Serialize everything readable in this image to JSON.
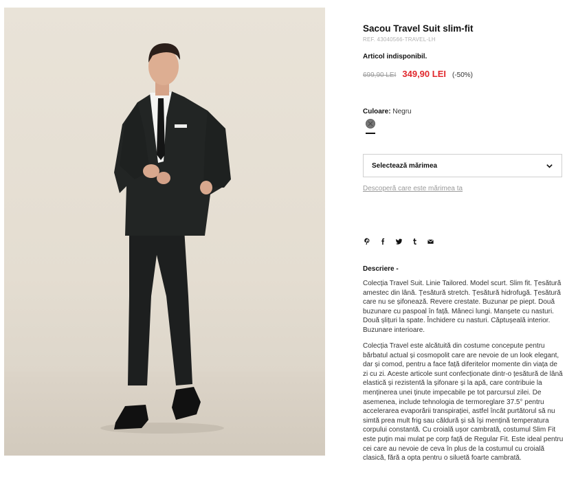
{
  "product": {
    "image_alt": "Model wearing Travel Suit slim-fit blazer",
    "title": "Sacou Travel Suit slim-fit",
    "ref": "REF. 43040566-TRAVEL-LH",
    "availability": "Articol indisponibil.",
    "old_price": "699,90 LEI",
    "new_price": "349,90 LEI",
    "discount": "(-50%)",
    "accent_color": "#e0282d"
  },
  "color": {
    "label": "Culoare:",
    "value": "Negru",
    "swatch_color": "#777777"
  },
  "size": {
    "select_label": "Selectează mărimea",
    "guide_link": "Descoperă care este mărimea ta"
  },
  "share": {
    "icons": [
      "pinterest-icon",
      "facebook-icon",
      "twitter-icon",
      "tumblr-icon",
      "email-icon"
    ]
  },
  "description": {
    "heading": "Descriere -",
    "paragraph1": "Colecția Travel Suit. Linie Tailored. Model scurt. Slim fit. Țesătură amestec din lână. Țesătură stretch. Țesătură hidrofugă. Țesătură care nu se șifonează. Revere crestate. Buzunar pe piept. Două buzunare cu paspoal în față. Mâneci lungi. Manșete cu nasturi. Două șlițuri la spate. Închidere cu nasturi. Căptușeală interior. Buzunare interioare.",
    "paragraph2": "Colecția Travel este alcătuită din costume concepute pentru bărbatul actual și cosmopolit care are nevoie de un look elegant, dar și comod, pentru a face față diferitelor momente din viața de zi cu zi. Aceste articole sunt confecționate dintr-o țesătură de lână elastică și rezistentă la șifonare și la apă, care contribuie la menținerea unei ținute impecabile pe tot parcursul zilei. De asemenea, include tehnologia de termoreglare 37.5° pentru accelerarea evaporării transpirației, astfel încât purtătorul să nu simtă prea mult frig sau căldură și să își mențină temperatura corpului constantă. Cu croială ușor cambrată, costumul Slim Fit este puțin mai mulat pe corp față de Regular Fit. Este ideal pentru cei care au nevoie de ceva în plus de la costumul cu croială clasică, fără a opta pentru o siluetă foarte cambrată."
  }
}
